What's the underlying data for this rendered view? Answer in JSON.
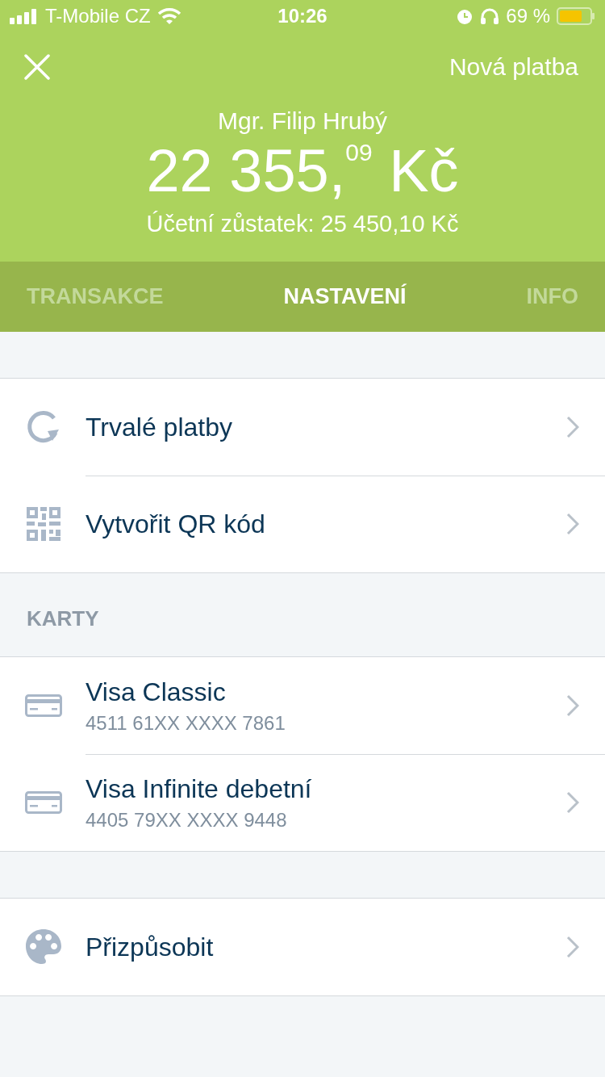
{
  "status_bar": {
    "carrier": "T-Mobile CZ",
    "time": "10:26",
    "battery": "69 %"
  },
  "header": {
    "action": "Nová platba",
    "owner": "Mgr. Filip Hrubý",
    "balance": "22 355,$^{09}$ Kč",
    "accounting_balance": "Účetní zůstatek: 25 450,10 Kč"
  },
  "tabs": [
    {
      "label": "TRANSAKCE",
      "selected": false
    },
    {
      "label": "NASTAVENÍ",
      "selected": true
    },
    {
      "label": "INFO",
      "selected": false
    }
  ],
  "sections": [
    {
      "items": [
        {
          "kind": "recurring",
          "title": "Trvalé platby"
        },
        {
          "kind": "qr",
          "title": "Vytvořit QR kód"
        }
      ]
    },
    {
      "title": "KARTY",
      "items": [
        {
          "kind": "card",
          "title": "Visa Classic",
          "subtitle": "4511 61XX XXXX 7861"
        },
        {
          "kind": "card",
          "title": "Visa Infinite debetní",
          "subtitle": "4405 79XX XXXX 9448"
        }
      ]
    },
    {
      "items": [
        {
          "kind": "customize",
          "title": "Přizpůsobit"
        }
      ]
    }
  ]
}
